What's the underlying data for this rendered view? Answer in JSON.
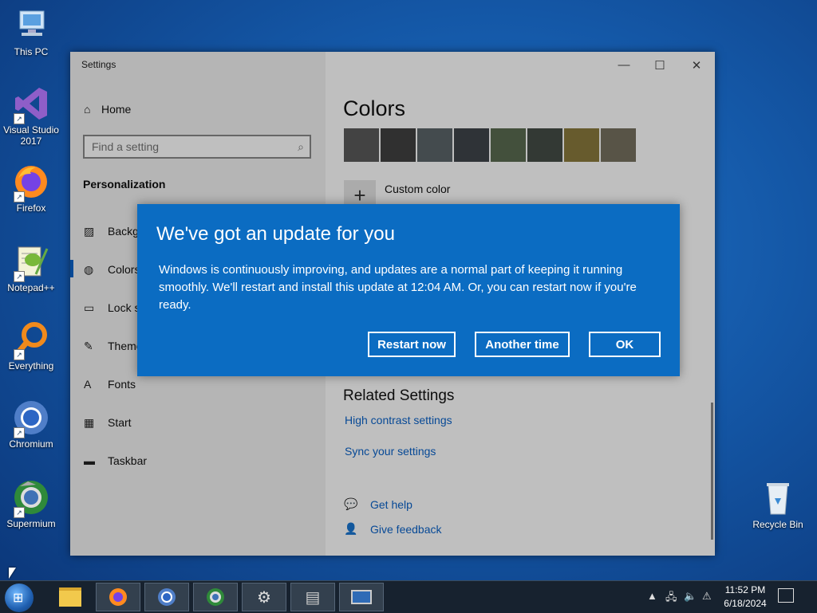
{
  "desktop": {
    "icons": [
      {
        "label": "This PC",
        "icon": "computer-icon"
      },
      {
        "label": "Visual Studio 2017",
        "icon": "visual-studio-icon"
      },
      {
        "label": "Firefox",
        "icon": "firefox-icon"
      },
      {
        "label": "Notepad++",
        "icon": "notepadpp-icon"
      },
      {
        "label": "Everything",
        "icon": "search-icon"
      },
      {
        "label": "Chromium",
        "icon": "chromium-icon"
      },
      {
        "label": "Supermium",
        "icon": "supermium-icon"
      }
    ],
    "recycle_bin": {
      "label": "Recycle Bin",
      "icon": "recycle-bin-icon"
    }
  },
  "settings_window": {
    "title": "Settings",
    "controls": {
      "minimize": "—",
      "maximize": "☐",
      "close": "✕"
    },
    "sidebar": {
      "home": "Home",
      "search_placeholder": "Find a setting",
      "section": "Personalization",
      "items": [
        {
          "label": "Backg",
          "icon": "image-icon"
        },
        {
          "label": "Colors",
          "icon": "palette-icon",
          "active": true
        },
        {
          "label": "Lock s",
          "icon": "lock-screen-icon"
        },
        {
          "label": "Theme",
          "icon": "brush-icon"
        },
        {
          "label": "Fonts",
          "icon": "fonts-icon"
        },
        {
          "label": "Start",
          "icon": "start-icon"
        },
        {
          "label": "Taskbar",
          "icon": "taskbar-icon"
        }
      ]
    },
    "main": {
      "heading": "Colors",
      "swatches": [
        "#5a5a5a",
        "#404040",
        "#5b6568",
        "#3f444a",
        "#5a6b51",
        "#454d46",
        "#8a7a3c",
        "#76705f"
      ],
      "custom_color": "Custom color",
      "related_heading": "Related Settings",
      "links": [
        "High contrast settings",
        "Sync your settings"
      ],
      "help": [
        "Get help",
        "Give feedback"
      ]
    }
  },
  "dialog": {
    "title": "We've got an update for you",
    "body": "Windows is continuously improving, and updates are a normal part of keeping it running smoothly. We'll restart and install this update at 12:04 AM. Or, you can restart now if you're ready.",
    "buttons": {
      "restart": "Restart now",
      "another": "Another time",
      "ok": "OK"
    },
    "background": "#0b6cc2"
  },
  "taskbar": {
    "items": [
      "file-explorer-icon",
      "firefox-icon",
      "chromium-icon",
      "supermium-icon",
      "settings-icon",
      "notepad-icon",
      "window-icon"
    ],
    "tray": {
      "time": "11:52 PM",
      "date": "6/18/2024"
    }
  }
}
